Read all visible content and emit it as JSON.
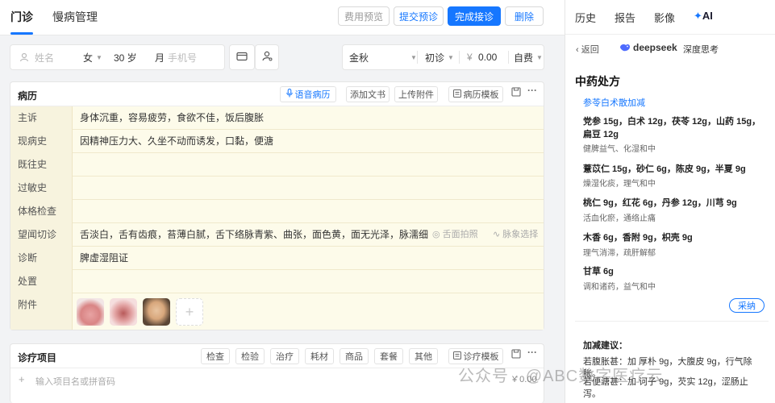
{
  "top_tabs": {
    "outpatient": "门诊",
    "chronic": "慢病管理"
  },
  "actions": {
    "fee_preview": "费用预览",
    "submit_prediagnosis": "提交预诊",
    "finish_visit": "完成接诊",
    "delete": "删除"
  },
  "patient": {
    "name_placeholder": "姓名",
    "sex": "女",
    "age": "30 岁",
    "month_label": "月",
    "phone_placeholder": "手机号",
    "doctor": "金秋",
    "visit_type": "初诊",
    "currency": "¥",
    "fee": "0.00",
    "pay_type": "自费"
  },
  "record": {
    "title": "病历",
    "voice_btn": "语音病历",
    "add_text_btn": "添加文书",
    "upload_btn": "上传附件",
    "template_btn": "病历模板",
    "rows": [
      {
        "label": "主诉",
        "value": "身体沉重，容易疲劳，食欲不佳，饭后腹胀"
      },
      {
        "label": "现病史",
        "value": "因精神压力大、久坐不动而诱发，口黏，便溏"
      },
      {
        "label": "既往史",
        "value": ""
      },
      {
        "label": "过敏史",
        "value": ""
      },
      {
        "label": "体格检查",
        "value": ""
      },
      {
        "label": "望闻切诊",
        "value": "舌淡白，舌有齿痕，苔薄白腻，舌下络脉青紫、曲张，面色黄，面无光泽，脉濡细"
      },
      {
        "label": "诊断",
        "value": "脾虚湿阻证"
      },
      {
        "label": "处置",
        "value": ""
      },
      {
        "label": "附件",
        "value": ""
      }
    ],
    "tongue_photo": "舌面拍照",
    "pulse_select": "脉象选择"
  },
  "treatment": {
    "title": "诊疗项目",
    "buttons": [
      "检查",
      "检验",
      "治疗",
      "耗材",
      "商品",
      "套餐",
      "其他"
    ],
    "template_btn": "诊疗模板",
    "input_placeholder": "输入项目名或拼音码",
    "total": "¥ 0.00"
  },
  "right_tabs": {
    "history": "历史",
    "report": "报告",
    "imaging": "影像",
    "ai": "AI"
  },
  "ai_panel": {
    "back": "返回",
    "brand": "deepseek",
    "mode": "深度思考",
    "rx_title": "中药处方",
    "formula": "参苓白术散加减",
    "herbs": [
      {
        "line": "党参 15g，白术 12g，茯苓 12g，山药 15g，扁豆 12g",
        "effect": "健脾益气、化湿和中"
      },
      {
        "line": "薏苡仁 15g，砂仁 6g，陈皮 9g，半夏 9g",
        "effect": "燥湿化痰，理气和中"
      },
      {
        "line": "桃仁 9g，红花 6g，丹参 12g，川芎 9g",
        "effect": "活血化瘀，通络止痛"
      },
      {
        "line": "木香 6g，香附 9g，枳壳 9g",
        "effect": "理气消滞，疏肝解郁"
      },
      {
        "line": "甘草 6g",
        "effect": "调和诸药，益气和中"
      }
    ],
    "accept_btn": "采纳",
    "adjust_title": "加减建议：",
    "adjust_1": "若腹胀甚：加 厚朴 9g，大腹皮 9g，行气除胀。",
    "adjust_2": "若便溏甚：加 诃子 9g，芡实 12g，涩肠止泻。"
  },
  "watermark": "公众号 · @ABC数字医疗云",
  "colors": {
    "primary": "#1677ff",
    "row_bg": "#fdfbea",
    "label_bg": "#f7f3de"
  }
}
